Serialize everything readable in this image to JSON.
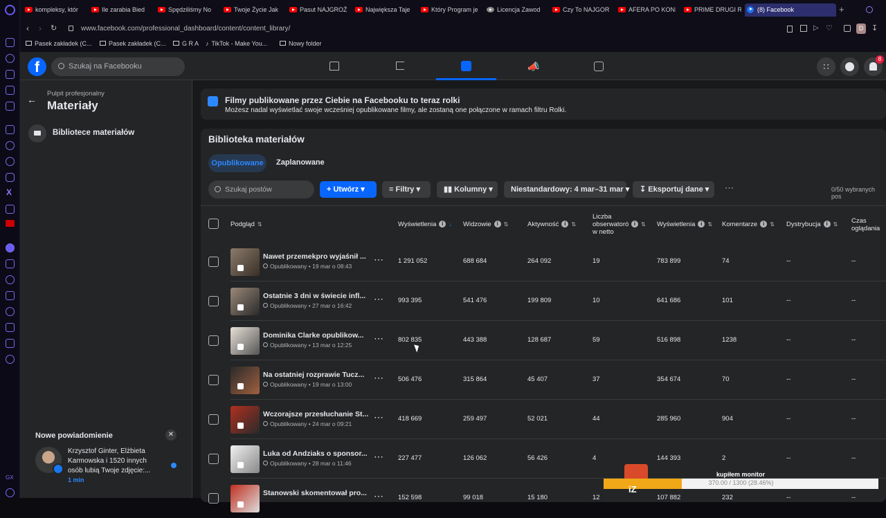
{
  "browser": {
    "tabs": [
      {
        "label": "kompleksy, któr"
      },
      {
        "label": "Ile zarabia Bied"
      },
      {
        "label": "Spędziliśmy No"
      },
      {
        "label": "Twoje Życie Jak"
      },
      {
        "label": "Pasut NAJGROŹ"
      },
      {
        "label": "Największa Taje"
      },
      {
        "label": "Który Program je"
      },
      {
        "label": "Licencja Zawod"
      },
      {
        "label": "Czy To NAJGOR"
      },
      {
        "label": "AFERA PO KONF"
      },
      {
        "label": "PRIME DRUGI R"
      },
      {
        "label": "(8) Facebook"
      }
    ],
    "url": "www.facebook.com/professional_dashboard/content/content_library/",
    "bookmarks": [
      {
        "label": "Pasek zakładek (C..."
      },
      {
        "label": "Pasek zakładek (C..."
      },
      {
        "label": "G R A"
      },
      {
        "label": "TikTok - Make You..."
      },
      {
        "label": "Nowy folder"
      }
    ],
    "profile_letter": "D",
    "accent": "#7b6cf0"
  },
  "fb": {
    "search_placeholder": "Szukaj na Facebooku",
    "notif_count": "8",
    "brand_color": "#0866ff"
  },
  "leftnav": {
    "subtitle": "Pulpit profesjonalny",
    "title": "Materiały",
    "item_label": "Bibliotece materiałów"
  },
  "banner": {
    "title": "Filmy publikowane przez Ciebie na Facebooku to teraz rolki",
    "text": "Możesz nadal wyświetlać swoje wcześniej opublikowane filmy, ale zostaną one połączone w ramach filtru Rolki."
  },
  "library": {
    "title": "Biblioteka materiałów",
    "tabs": [
      "Opublikowane",
      "Zaplanowane"
    ],
    "search_placeholder": "Szukaj postów",
    "create_label": "Utwórz",
    "filters_label": "Filtry",
    "columns_label": "Kolumny",
    "date_label": "Niestandardowy: 4 mar–31 mar",
    "export_label": "Eksportuj dane",
    "selected_count": "0/50 wybranych pos"
  },
  "table": {
    "headers": {
      "preview": "Podgląd",
      "views": "Wyświetlenia",
      "viewers": "Widzowie",
      "activity": "Aktywność",
      "followers_1": "Liczba",
      "followers_2": "obserwatorów",
      "followers_3": "w netto",
      "views2": "Wyświetlenia",
      "comments": "Komentarze",
      "distribution": "Dystrybucja",
      "watch_1": "Czas",
      "watch_2": "oglądania"
    },
    "rows": [
      {
        "title": "Nawet przemekpro wyjaśnił ...",
        "status": "Opublikowany • 19 mar o 08:43",
        "views": "1 291 052",
        "viewers": "688 684",
        "activity": "264 092",
        "followers": "19",
        "views2": "783 899",
        "comments": "74",
        "distribution": "--",
        "watch": "--"
      },
      {
        "title": "Ostatnie 3 dni w świecie infl...",
        "status": "Opublikowany • 27 mar o 16:42",
        "views": "993 395",
        "viewers": "541 476",
        "activity": "199 809",
        "followers": "10",
        "views2": "641 686",
        "comments": "101",
        "distribution": "--",
        "watch": "--"
      },
      {
        "title": "Dominika Clarke opublikow...",
        "status": "Opublikowany • 13 mar o 12:25",
        "views": "802 835",
        "viewers": "443 388",
        "activity": "128 687",
        "followers": "59",
        "views2": "516 898",
        "comments": "1238",
        "distribution": "--",
        "watch": "--"
      },
      {
        "title": "Na ostatniej rozprawie Tucz...",
        "status": "Opublikowany • 19 mar o 13:00",
        "views": "506 476",
        "viewers": "315 864",
        "activity": "45 407",
        "followers": "37",
        "views2": "354 674",
        "comments": "70",
        "distribution": "--",
        "watch": "--"
      },
      {
        "title": "Wczorajsze przesłuchanie St...",
        "status": "Opublikowany • 24 mar o 09:21",
        "views": "418 669",
        "viewers": "259 497",
        "activity": "52 021",
        "followers": "44",
        "views2": "285 960",
        "comments": "904",
        "distribution": "--",
        "watch": "--"
      },
      {
        "title": "Luka od Andziaks o sponsor...",
        "status": "Opublikowany • 28 mar o 11:46",
        "views": "227 477",
        "viewers": "126 062",
        "activity": "56 426",
        "followers": "4",
        "views2": "144 393",
        "comments": "2",
        "distribution": "--",
        "watch": "--"
      },
      {
        "title": "Stanowski skomentował pro...",
        "status": "",
        "views": "152 598",
        "viewers": "99 018",
        "activity": "15 180",
        "followers": "12",
        "views2": "107 882",
        "comments": "232",
        "distribution": "--",
        "watch": "--"
      }
    ]
  },
  "notification": {
    "heading": "Nowe powiadomienie",
    "line1": "Krzysztof Ginter, Elżbieta",
    "line2": "Karmowska i 1520 innych",
    "line3": "osób lubią Twoje zdjęcie:...",
    "time": "1 min"
  },
  "overlay": {
    "goal_label": "kupiłem monitor",
    "goal_text": "370.00 / 1300 (28.46%)",
    "goal_fraction": 0.2846,
    "badge": "iZ"
  }
}
